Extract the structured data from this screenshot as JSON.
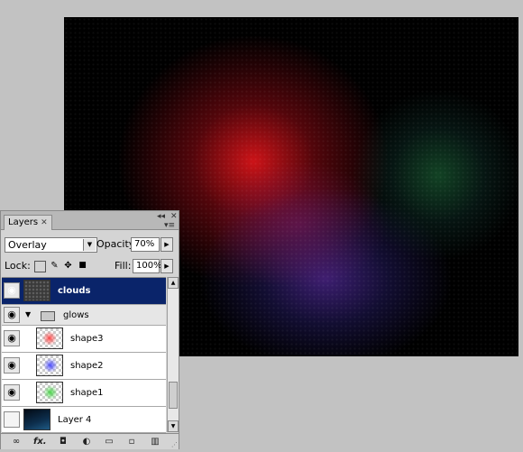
{
  "panel": {
    "tab_label": "Layers",
    "tab_close": "✕",
    "minimize": "◂◂",
    "close": "✕",
    "menu": "▾≡"
  },
  "blend": {
    "mode": "Overlay",
    "opacity_label": "Opacity:",
    "opacity_value": "70%",
    "lock_label": "Lock:",
    "fill_label": "Fill:",
    "fill_value": "100%"
  },
  "layers": [
    {
      "name": "clouds",
      "selected": true,
      "visible": true
    },
    {
      "name": "glows",
      "type": "group",
      "visible": true
    },
    {
      "name": "shape3",
      "visible": true,
      "color": "#ff4d4d"
    },
    {
      "name": "shape2",
      "visible": true,
      "color": "#4d4dff"
    },
    {
      "name": "shape1",
      "visible": true,
      "color": "#4dd94d"
    },
    {
      "name": "Layer 4",
      "visible": false
    }
  ],
  "icons": {
    "eye": "👁",
    "folder": "▭",
    "expand": "▾",
    "link": "⊖",
    "fx": "fx.",
    "mask": "◘",
    "adjust": "◐",
    "group": "▭",
    "new": "▫",
    "trash": "🗑",
    "lock_transparent": "▦",
    "lock_paint": "✎",
    "lock_move": "✥",
    "lock_all": "🔒"
  },
  "canvas": {
    "background": "#000000",
    "glow_colors": [
      "#d71419",
      "#502896",
      "#1e6e3c"
    ]
  }
}
